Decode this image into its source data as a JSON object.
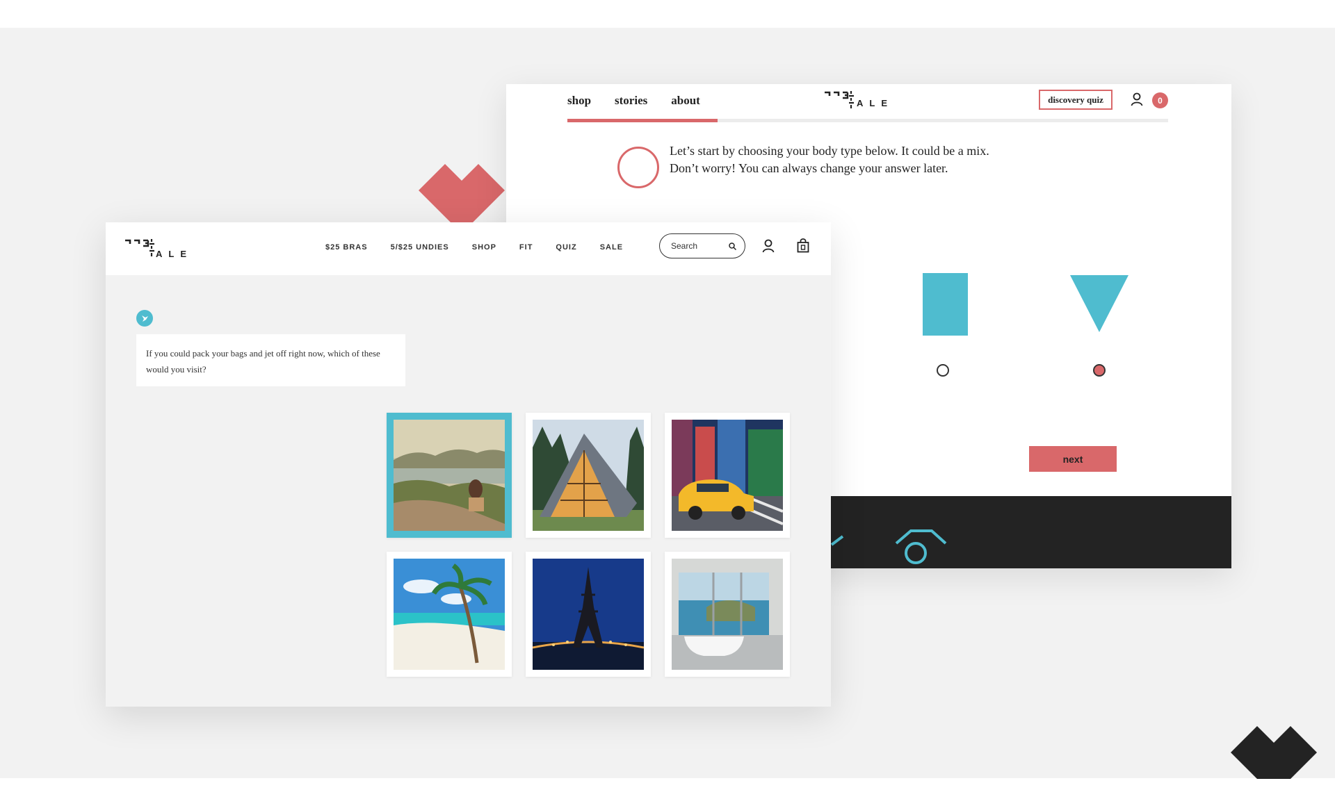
{
  "quiz_page": {
    "nav": [
      "shop",
      "stories",
      "about"
    ],
    "logo_word": "ALE",
    "discovery_quiz_label": "discovery quiz",
    "cart_count": "0",
    "progress_fraction": 0.25,
    "question_lines": [
      "Let’s start by choosing your body type below. It could be a mix.",
      "Don’t worry! You can always change your answer later."
    ],
    "body_type_options": [
      {
        "shape": "rectangle",
        "selected": false
      },
      {
        "shape": "inverted-triangle",
        "selected": true
      }
    ],
    "next_label": "next"
  },
  "chat_page": {
    "logo_word": "ALE",
    "nav": [
      "$25 BRAS",
      "5/$25 UNDIES",
      "SHOP",
      "FIT",
      "QUIZ",
      "SALE"
    ],
    "search": {
      "placeholder": "Search"
    },
    "question": "If you could pack your bags and jet off right now, which of these would you visit?",
    "destinations": [
      {
        "scene": "coastal-hillside-traveler",
        "selected": true
      },
      {
        "scene": "a-frame-cabin-forest",
        "selected": false
      },
      {
        "scene": "city-yellow-taxi",
        "selected": false
      },
      {
        "scene": "tropical-beach-palms",
        "selected": false
      },
      {
        "scene": "eiffel-tower-night",
        "selected": false
      },
      {
        "scene": "ocean-view-bathroom",
        "selected": false
      }
    ]
  },
  "colors": {
    "accent_red": "#d9686a",
    "accent_teal": "#4fbccf",
    "dark": "#232323",
    "background": "#f2f2f2"
  }
}
